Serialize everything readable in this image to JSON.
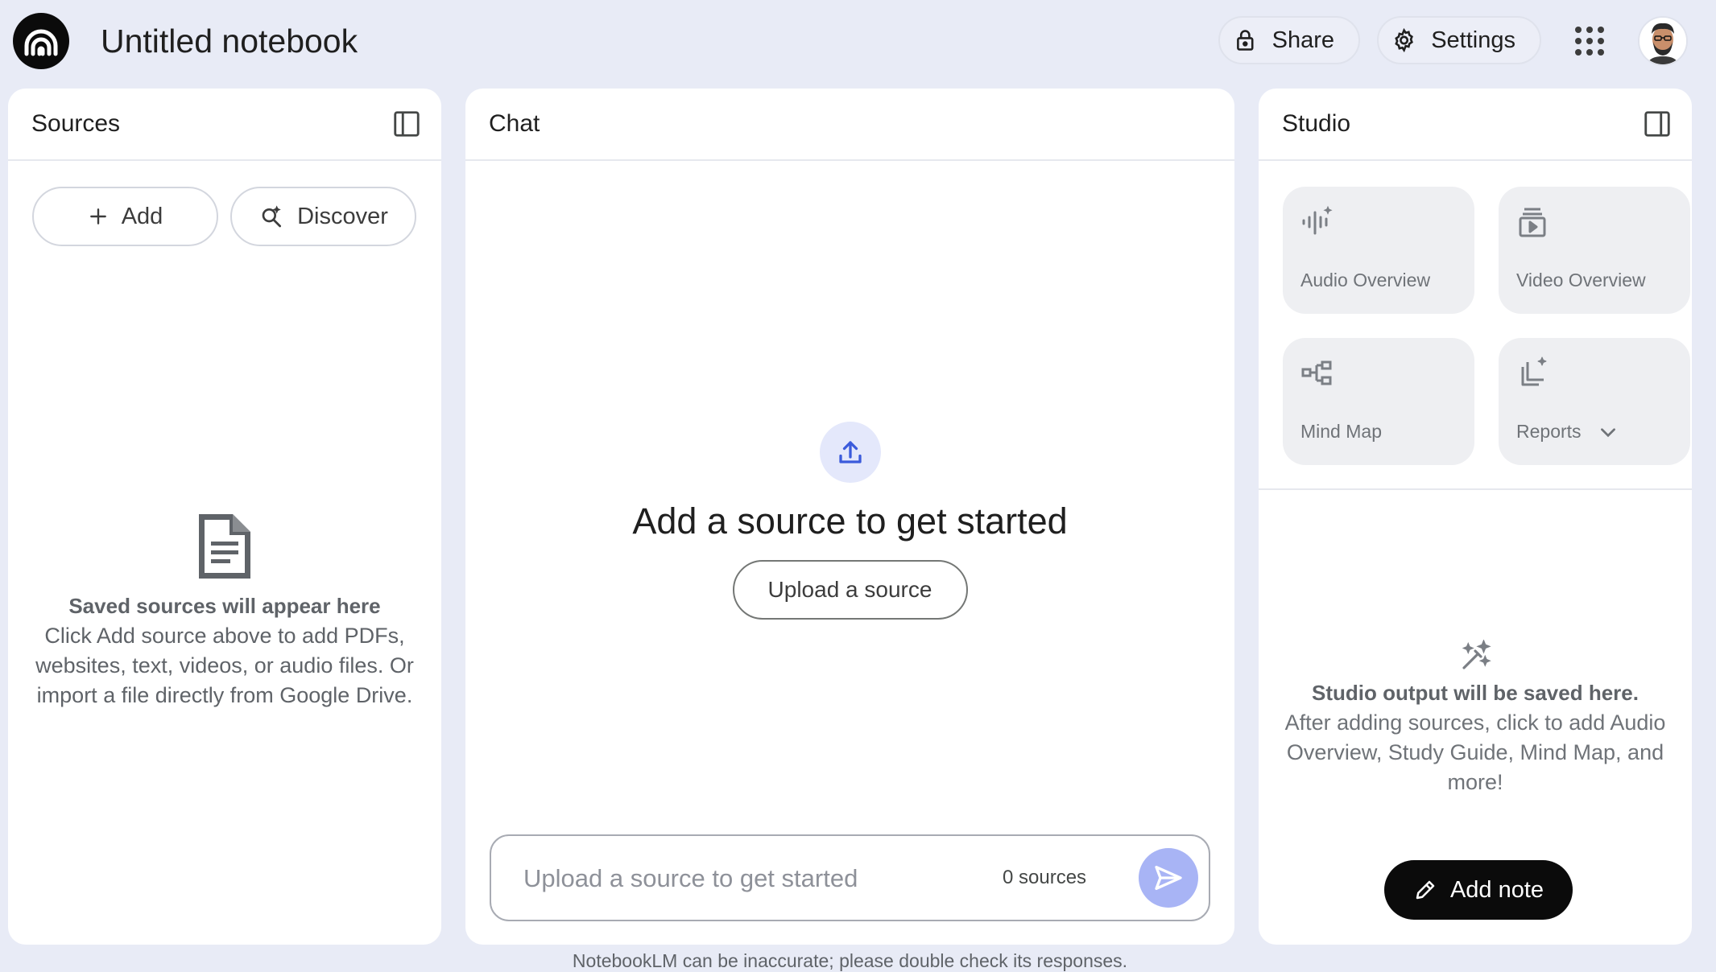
{
  "header": {
    "notebook_title": "Untitled notebook",
    "share_label": "Share",
    "settings_label": "Settings"
  },
  "sources": {
    "title": "Sources",
    "add_label": "Add",
    "discover_label": "Discover",
    "empty_heading": "Saved sources will appear here",
    "empty_body": "Click Add source above to add PDFs, websites, text, videos, or audio files. Or import a file directly from Google Drive."
  },
  "chat": {
    "title": "Chat",
    "heading": "Add a source to get started",
    "upload_label": "Upload a source",
    "input_placeholder": "Upload a source to get started",
    "source_count": "0 sources"
  },
  "studio": {
    "title": "Studio",
    "cards": [
      {
        "label": "Audio Overview"
      },
      {
        "label": "Video Overview"
      },
      {
        "label": "Mind Map"
      },
      {
        "label": "Reports"
      }
    ],
    "empty_heading": "Studio output will be saved here.",
    "empty_body": "After adding sources, click to add Audio Overview, Study Guide, Mind Map, and more!",
    "add_note_label": "Add note"
  },
  "footer": {
    "disclaimer": "NotebookLM can be inaccurate; please double check its responses."
  },
  "colors": {
    "page_bg": "#e8ebf6",
    "send_button": "#a8b4f5",
    "upload_circle": "#e4e8fb",
    "accent_blue": "#3b5bdb",
    "dark_button": "#0b0b0b"
  }
}
